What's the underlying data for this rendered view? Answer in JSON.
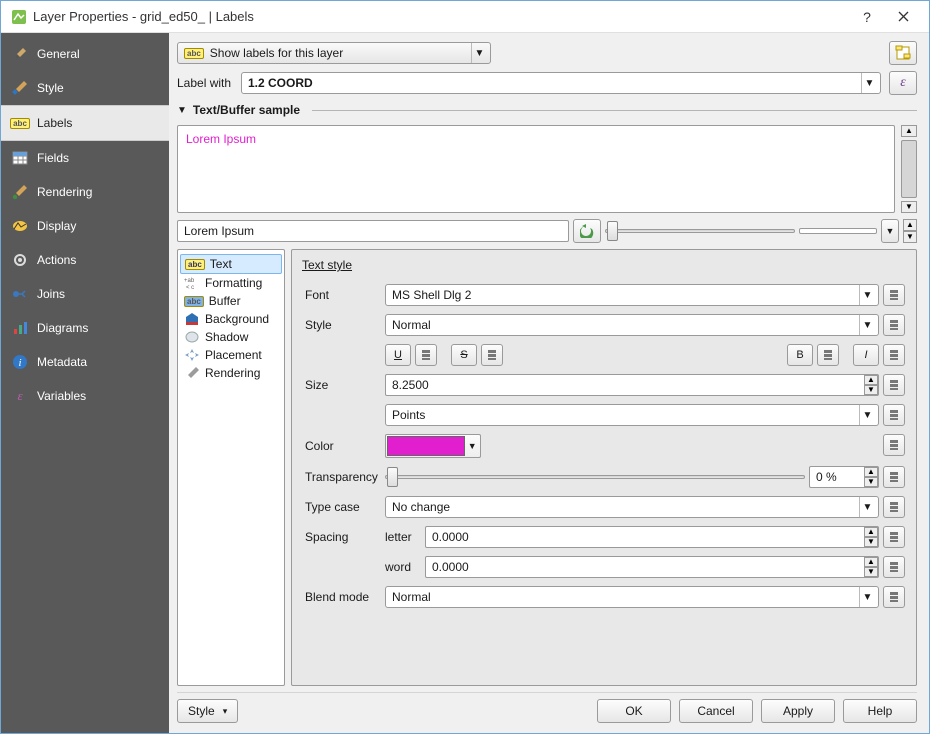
{
  "window": {
    "title": "Layer Properties - grid_ed50_ | Labels"
  },
  "sidebar": {
    "items": [
      {
        "label": "General"
      },
      {
        "label": "Style"
      },
      {
        "label": "Labels"
      },
      {
        "label": "Fields"
      },
      {
        "label": "Rendering"
      },
      {
        "label": "Display"
      },
      {
        "label": "Actions"
      },
      {
        "label": "Joins"
      },
      {
        "label": "Diagrams"
      },
      {
        "label": "Metadata"
      },
      {
        "label": "Variables"
      }
    ],
    "active_index": 2
  },
  "top": {
    "mode_display": "Show labels for this layer",
    "label_with_caption": "Label with",
    "label_with_value": "1.2 COORD",
    "epsilon": "ε"
  },
  "preview": {
    "header": "Text/Buffer sample",
    "sample_text": "Lorem Ipsum",
    "edit_text": "Lorem Ipsum"
  },
  "sub_tabs": [
    "Text",
    "Formatting",
    "Buffer",
    "Background",
    "Shadow",
    "Placement",
    "Rendering"
  ],
  "form": {
    "title": "Text style",
    "font_label": "Font",
    "font_value": "MS Shell Dlg 2",
    "style_label": "Style",
    "style_value": "Normal",
    "u_btn": "U",
    "s_btn": "S",
    "b_btn": "B",
    "i_btn": "I",
    "size_label": "Size",
    "size_value": "8.2500",
    "size_unit": "Points",
    "color_label": "Color",
    "color_hex": "#e21fcf",
    "transparency_label": "Transparency",
    "transparency_value": "0 %",
    "typecase_label": "Type case",
    "typecase_value": "No change",
    "spacing_label": "Spacing",
    "spacing_letter_label": "letter",
    "spacing_letter_value": "0.0000",
    "spacing_word_label": "word",
    "spacing_word_value": "0.0000",
    "blend_label": "Blend mode",
    "blend_value": "Normal"
  },
  "bottom": {
    "style_menu": "Style",
    "ok": "OK",
    "cancel": "Cancel",
    "apply": "Apply",
    "help": "Help"
  }
}
